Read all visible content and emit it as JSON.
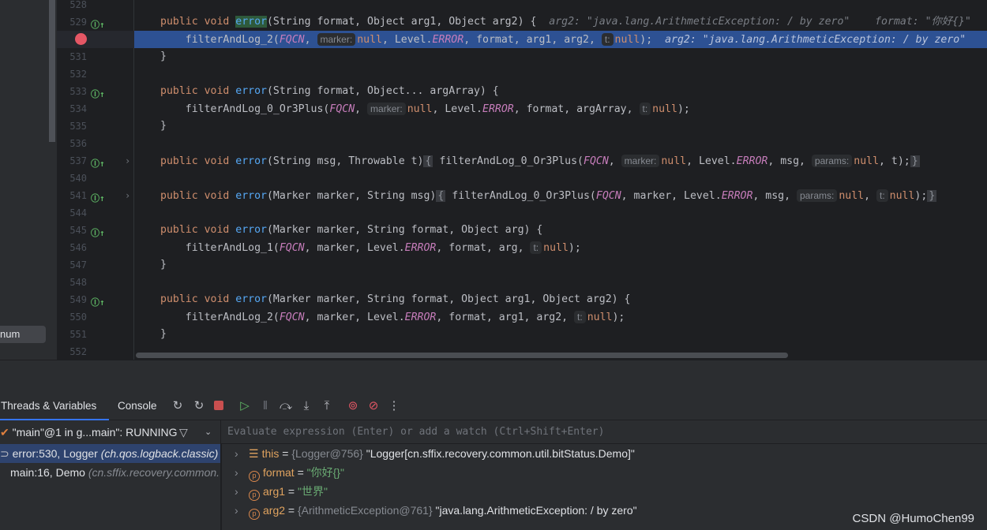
{
  "left_panel": {
    "item": "num"
  },
  "editor": {
    "lines": [
      {
        "n": "528",
        "tokens": []
      },
      {
        "n": "529",
        "override": true,
        "tokens": [
          [
            "kw",
            "public void "
          ],
          [
            "sel",
            "error"
          ],
          [
            "tx",
            "(String format, Object arg1, Object arg2) {  "
          ],
          [
            "ih",
            "arg2: \"java.lang.ArithmeticException: / by zero\"    format: \"你好{}\""
          ]
        ]
      },
      {
        "n": "530",
        "breakpoint": true,
        "current": true,
        "tokens": [
          [
            "tx",
            "    filterAndLog_2("
          ],
          [
            "it",
            "FQCN"
          ],
          [
            "tx",
            ", "
          ],
          [
            "hint",
            "marker:"
          ],
          [
            "nl",
            "null"
          ],
          [
            "tx",
            ", Level."
          ],
          [
            "it",
            "ERROR"
          ],
          [
            "tx",
            ", format, arg1, arg2, "
          ],
          [
            "hint",
            "t:"
          ],
          [
            "nl",
            "null"
          ],
          [
            "tx",
            ");  "
          ],
          [
            "ih",
            "arg2: \"java.lang.ArithmeticException: / by zero\""
          ]
        ]
      },
      {
        "n": "531",
        "tokens": [
          [
            "tx",
            "}"
          ]
        ]
      },
      {
        "n": "532",
        "tokens": []
      },
      {
        "n": "533",
        "override": true,
        "tokens": [
          [
            "kw",
            "public void "
          ],
          [
            "fn",
            "error"
          ],
          [
            "tx",
            "(String format, Object... argArray) {"
          ]
        ]
      },
      {
        "n": "534",
        "tokens": [
          [
            "tx",
            "    filterAndLog_0_Or3Plus("
          ],
          [
            "it",
            "FQCN"
          ],
          [
            "tx",
            ", "
          ],
          [
            "hint",
            "marker:"
          ],
          [
            "nl",
            "null"
          ],
          [
            "tx",
            ", Level."
          ],
          [
            "it",
            "ERROR"
          ],
          [
            "tx",
            ", format, argArray, "
          ],
          [
            "hint",
            "t:"
          ],
          [
            "nl",
            "null"
          ],
          [
            "tx",
            ");"
          ]
        ]
      },
      {
        "n": "535",
        "tokens": [
          [
            "tx",
            "}"
          ]
        ]
      },
      {
        "n": "536",
        "tokens": []
      },
      {
        "n": "537",
        "override": true,
        "folded": true,
        "tokens": [
          [
            "kw",
            "public void "
          ],
          [
            "fn",
            "error"
          ],
          [
            "tx",
            "(String msg, Throwable t)"
          ],
          [
            "brace",
            "{"
          ],
          [
            "tx",
            " filterAndLog_0_Or3Plus("
          ],
          [
            "it",
            "FQCN"
          ],
          [
            "tx",
            ", "
          ],
          [
            "hint",
            "marker:"
          ],
          [
            "nl",
            "null"
          ],
          [
            "tx",
            ", Level."
          ],
          [
            "it",
            "ERROR"
          ],
          [
            "tx",
            ", msg, "
          ],
          [
            "hint",
            "params:"
          ],
          [
            "nl",
            "null"
          ],
          [
            "tx",
            ", t);"
          ],
          [
            "brace",
            "}"
          ]
        ]
      },
      {
        "n": "540",
        "tokens": []
      },
      {
        "n": "541",
        "override": true,
        "folded": true,
        "tokens": [
          [
            "kw",
            "public void "
          ],
          [
            "fn",
            "error"
          ],
          [
            "tx",
            "(Marker marker, String msg)"
          ],
          [
            "brace",
            "{"
          ],
          [
            "tx",
            " filterAndLog_0_Or3Plus("
          ],
          [
            "it",
            "FQCN"
          ],
          [
            "tx",
            ", marker, Level."
          ],
          [
            "it",
            "ERROR"
          ],
          [
            "tx",
            ", msg, "
          ],
          [
            "hint",
            "params:"
          ],
          [
            "nl",
            "null"
          ],
          [
            "tx",
            ", "
          ],
          [
            "hint",
            "t:"
          ],
          [
            "nl",
            "null"
          ],
          [
            "tx",
            ");"
          ],
          [
            "brace",
            "}"
          ]
        ]
      },
      {
        "n": "544",
        "tokens": []
      },
      {
        "n": "545",
        "override": true,
        "tokens": [
          [
            "kw",
            "public void "
          ],
          [
            "fn",
            "error"
          ],
          [
            "tx",
            "(Marker marker, String format, Object arg) {"
          ]
        ]
      },
      {
        "n": "546",
        "tokens": [
          [
            "tx",
            "    filterAndLog_1("
          ],
          [
            "it",
            "FQCN"
          ],
          [
            "tx",
            ", marker, Level."
          ],
          [
            "it",
            "ERROR"
          ],
          [
            "tx",
            ", format, arg, "
          ],
          [
            "hint",
            "t:"
          ],
          [
            "nl",
            "null"
          ],
          [
            "tx",
            ");"
          ]
        ]
      },
      {
        "n": "547",
        "tokens": [
          [
            "tx",
            "}"
          ]
        ]
      },
      {
        "n": "548",
        "tokens": []
      },
      {
        "n": "549",
        "override": true,
        "tokens": [
          [
            "kw",
            "public void "
          ],
          [
            "fn",
            "error"
          ],
          [
            "tx",
            "(Marker marker, String format, Object arg1, Object arg2) {"
          ]
        ]
      },
      {
        "n": "550",
        "tokens": [
          [
            "tx",
            "    filterAndLog_2("
          ],
          [
            "it",
            "FQCN"
          ],
          [
            "tx",
            ", marker, Level."
          ],
          [
            "it",
            "ERROR"
          ],
          [
            "tx",
            ", format, arg1, arg2, "
          ],
          [
            "hint",
            "t:"
          ],
          [
            "nl",
            "null"
          ],
          [
            "tx",
            ");"
          ]
        ]
      },
      {
        "n": "551",
        "tokens": [
          [
            "tx",
            "}"
          ]
        ]
      },
      {
        "n": "552",
        "tokens": []
      }
    ]
  },
  "debug": {
    "tabs": {
      "threads": "Threads & Variables",
      "console": "Console"
    },
    "toolbar_icons": [
      "rerun-icon",
      "rerun-debug-icon",
      "stop-icon",
      "resume-icon",
      "pause-icon",
      "step-over-icon",
      "step-into-icon",
      "step-out-icon",
      "view-breakpoints-icon",
      "mute-breakpoints-icon",
      "more-icon"
    ],
    "thread": "\"main\"@1 in g...main\": RUNNING",
    "eval_placeholder": "Evaluate expression (Enter) or add a watch (Ctrl+Shift+Enter)",
    "frames": [
      {
        "loc": "error:530, Logger ",
        "pkg": "(ch.qos.logback.classic)"
      },
      {
        "loc": "main:16, Demo ",
        "pkg": "(cn.sffix.recovery.common."
      }
    ],
    "variables": [
      {
        "name": "this",
        "type": "{Logger@756}",
        "value": "\"Logger[cn.sffix.recovery.common.util.bitStatus.Demo]\"",
        "kind": "object"
      },
      {
        "name": "format",
        "type": "",
        "value": "\"你好{}\"",
        "kind": "param"
      },
      {
        "name": "arg1",
        "type": "",
        "value": "\"世界\"",
        "kind": "param"
      },
      {
        "name": "arg2",
        "type": "{ArithmeticException@761}",
        "value": "\"java.lang.ArithmeticException: / by zero\"",
        "kind": "param"
      }
    ]
  },
  "watermark": "CSDN @HumoChen99"
}
